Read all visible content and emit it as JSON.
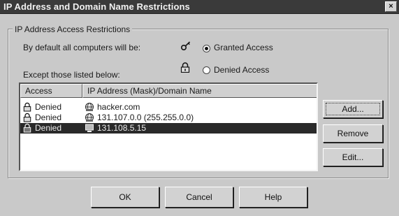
{
  "window": {
    "title": "IP Address and Domain Name Restrictions",
    "close_glyph": "×"
  },
  "group": {
    "label": "IP Address Access Restrictions",
    "default_text": "By default all computers will be:",
    "granted_label": "Granted Access",
    "denied_label": "Denied Access",
    "granted_selected": true,
    "except_text": "Except those listed below:"
  },
  "list": {
    "columns": [
      "Access",
      "IP Address (Mask)/Domain Name"
    ],
    "rows": [
      {
        "access": "Denied",
        "address": "hacker.com",
        "icon": "globe-icon",
        "selected": false
      },
      {
        "access": "Denied",
        "address": "131.107.0.0 (255.255.0.0)",
        "icon": "globe-icon",
        "selected": false
      },
      {
        "access": "Denied",
        "address": "131.108.5.15",
        "icon": "computer-icon",
        "selected": true
      }
    ]
  },
  "side_buttons": {
    "add": "Add...",
    "remove": "Remove",
    "edit": "Edit..."
  },
  "footer_buttons": {
    "ok": "OK",
    "cancel": "Cancel",
    "help": "Help"
  }
}
